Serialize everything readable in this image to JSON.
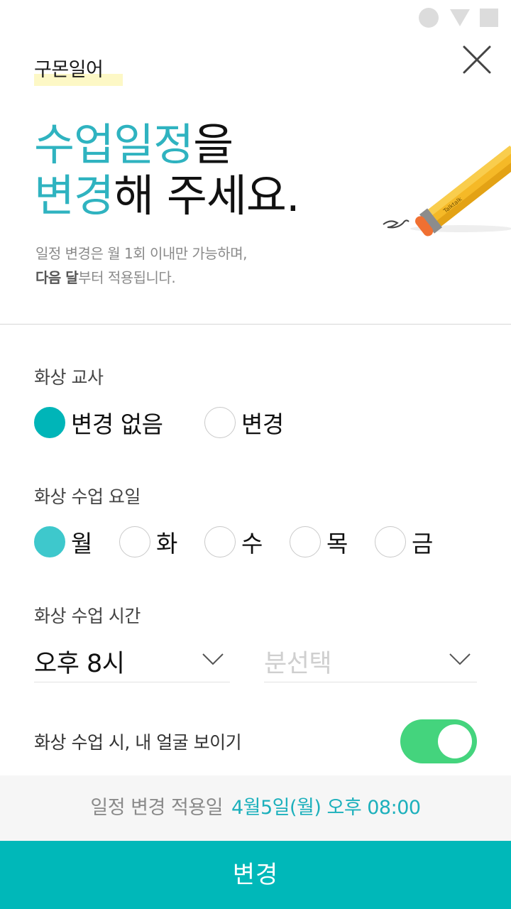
{
  "status_bar": {
    "icons": [
      "circle-icon",
      "triangle-icon",
      "square-icon"
    ]
  },
  "header": {
    "brand": "구몬일어",
    "close_icon": "close-icon"
  },
  "headline": {
    "line1_accent": "수업일정",
    "line1_rest": "을",
    "line2_accent": "변경",
    "line2_rest": "해 주세요."
  },
  "subtext": {
    "line1": "일정 변경은 월 1회 이내만 가능하며,",
    "line2_bold": "다음 달",
    "line2_rest": "부터 적용됩니다."
  },
  "illustration": {
    "pencil_brand": "Talktalk"
  },
  "teacher": {
    "label": "화상 교사",
    "options": [
      {
        "label": "변경 없음",
        "selected": true
      },
      {
        "label": "변경",
        "selected": false
      }
    ]
  },
  "day": {
    "label": "화상 수업 요일",
    "options": [
      {
        "label": "월",
        "selected": true
      },
      {
        "label": "화",
        "selected": false
      },
      {
        "label": "수",
        "selected": false
      },
      {
        "label": "목",
        "selected": false
      },
      {
        "label": "금",
        "selected": false
      }
    ]
  },
  "time": {
    "label": "화상 수업 시간",
    "hour_value": "오후 8시",
    "minute_placeholder": "분선택"
  },
  "face_toggle": {
    "label": "화상 수업 시, 내 얼굴 보이기",
    "on": true
  },
  "apply": {
    "label": "일정 변경 적용일",
    "date": "4월5일(월) 오후 08:00"
  },
  "submit": {
    "label": "변경"
  },
  "colors": {
    "accent": "#2fb3c0",
    "primary_button": "#00b8b9",
    "toggle_on": "#44d47d",
    "brand_highlight": "#fdf8c6"
  }
}
